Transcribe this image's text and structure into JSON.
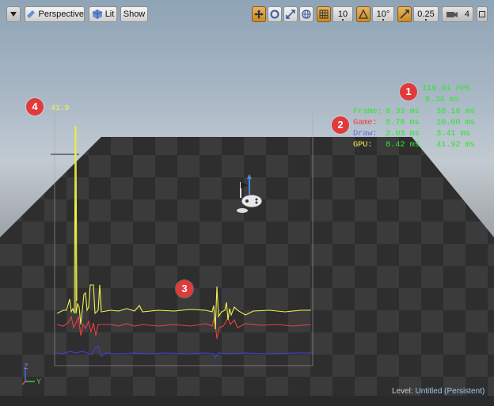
{
  "toolbar": {
    "dropdown_icon": "chevron-down-icon",
    "view_mode": "Perspective",
    "lit_mode": "Lit",
    "show_label": "Show",
    "grid_snap_value": "10",
    "rotation_snap_value": "10°",
    "scale_snap_value": "0.25",
    "camera_speed_value": "4"
  },
  "stats": {
    "fps": "119.91 FPS",
    "frame_time": "8.34 ms",
    "rows": [
      {
        "label": "Frame:",
        "current": "8.33 ms",
        "max": "38.18 ms"
      },
      {
        "label": "Game:",
        "current": "5.78 ms",
        "max": "10.00 ms"
      },
      {
        "label": "Draw:",
        "current": "2.03 ms",
        "max": "3.41 ms"
      },
      {
        "label": "GPU:",
        "current": "8.42 ms",
        "max": "41.92 ms"
      }
    ],
    "graph_peak": "41.9"
  },
  "callouts": [
    "1",
    "2",
    "3",
    "4"
  ],
  "footer": {
    "level_label": "Level:",
    "level_name": "Untitled (Persistent)"
  },
  "axis": {
    "z": "Z",
    "y": "Y"
  },
  "colors": {
    "frame": "#f0f050",
    "game": "#e84040",
    "draw": "#4040e0",
    "gpu": "#e8e840",
    "stat_text": "#2ee62e",
    "toolbar_active": "#d49a3a"
  }
}
